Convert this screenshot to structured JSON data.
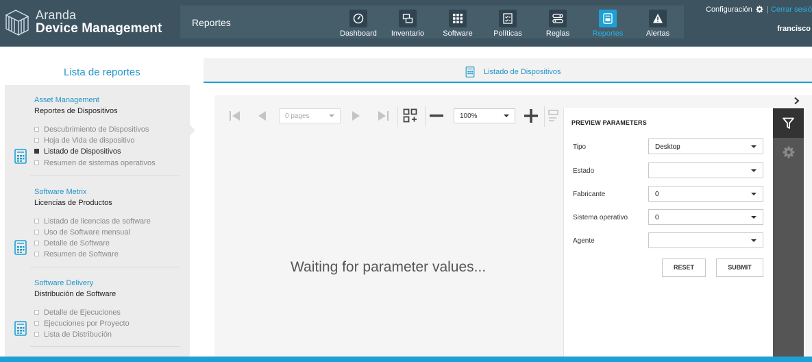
{
  "app": {
    "brand_line1": "Aranda",
    "brand_line2": "Device Management",
    "section_title": "Reportes",
    "config_label": "Configuración",
    "separator": "|",
    "logout_label": "Cerrar sesión",
    "user": "francisco",
    "accent_color": "#1ea0d6",
    "header_color": "#3d5360"
  },
  "nav": [
    {
      "label": "Dashboard",
      "icon": "gauge-icon"
    },
    {
      "label": "Inventario",
      "icon": "computers-icon"
    },
    {
      "label": "Software",
      "icon": "grid-icon"
    },
    {
      "label": "Políticas",
      "icon": "checklist-icon"
    },
    {
      "label": "Reglas",
      "icon": "rules-icon"
    },
    {
      "label": "Reportes",
      "icon": "report-icon",
      "active": true
    },
    {
      "label": "Alertas",
      "icon": "alert-icon"
    }
  ],
  "left": {
    "title": "Lista de reportes",
    "groups": [
      {
        "category": "Asset Management",
        "name": "Reportes de Dispositivos",
        "items": [
          "Descubrimiento de Dispositivos",
          "Hoja de Vida de dispositivo",
          "Listado de Dispositivos",
          "Resumen de sistemas operativos"
        ]
      },
      {
        "category": "Software Metrix",
        "name": "Licencias de Productos",
        "items": [
          "Listado de licencias de software",
          "Uso de Software mensual",
          "Detalle de Software",
          "Resumen de Software"
        ]
      },
      {
        "category": "Software Delivery",
        "name": "Distribución de Software",
        "items": [
          "Detalle de Ejecuciones",
          "Ejecuciones por Proyecto",
          "Lista de Distribución"
        ]
      }
    ]
  },
  "main": {
    "tab_label": "Listado de Dispositivos",
    "pages_placeholder": "0 pages",
    "zoom_value": "100%",
    "waiting_message": "Waiting for parameter values..."
  },
  "params": {
    "title": "PREVIEW PARAMETERS",
    "fields": [
      {
        "label": "Tipo",
        "value": "Desktop"
      },
      {
        "label": "Estado",
        "value": ""
      },
      {
        "label": "Fabricante",
        "value": "0"
      },
      {
        "label": "Sistema operativo",
        "value": "0"
      },
      {
        "label": "Agente",
        "value": ""
      }
    ],
    "reset_label": "RESET",
    "submit_label": "SUBMIT"
  }
}
